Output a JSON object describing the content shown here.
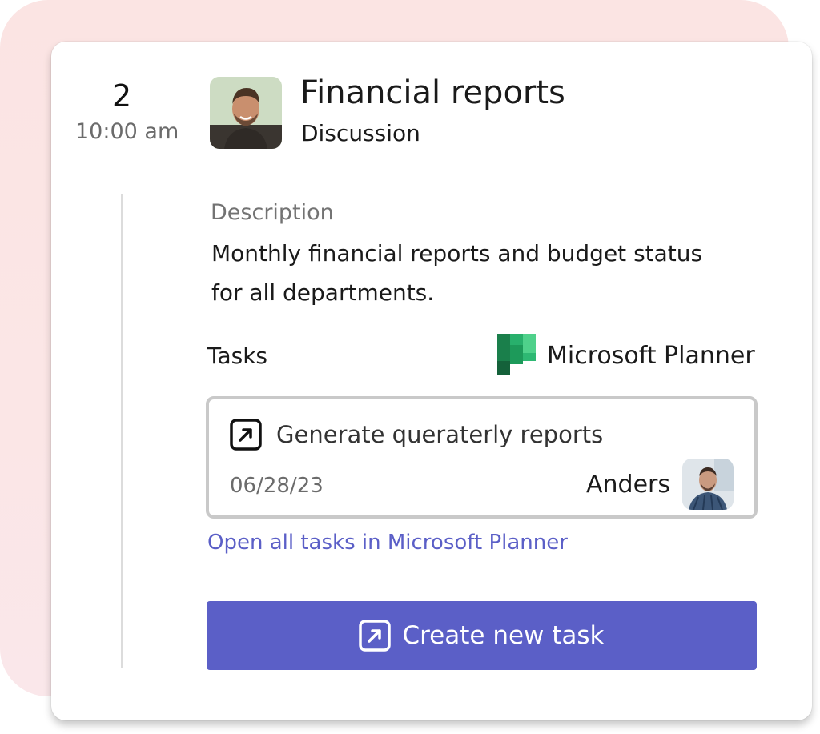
{
  "meeting": {
    "number": "2",
    "time": "10:00 am",
    "title": "Financial reports",
    "subtitle": "Discussion"
  },
  "description": {
    "label": "Description",
    "text": "Monthly financial reports and budget status for all departments."
  },
  "tasks": {
    "label": "Tasks",
    "app_name": "Microsoft Planner",
    "app_icon": "microsoft-planner-icon",
    "items": [
      {
        "name": "Generate queraterly reports",
        "date": "06/28/23",
        "assignee": "Anders",
        "icon": "open-external-icon"
      }
    ],
    "open_all_link": "Open all tasks in Microsoft Planner",
    "create_button": "Create new task"
  },
  "colors": {
    "accent": "#5b5fc7",
    "planner_green": "#1d9a5a",
    "background_blob": "#fbe4e3"
  }
}
